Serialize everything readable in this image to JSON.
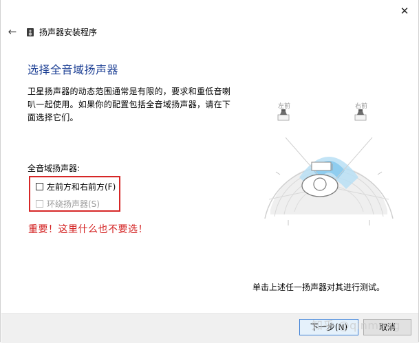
{
  "window": {
    "close_glyph": "✕",
    "back_glyph": "←",
    "app_title": "扬声器安装程序"
  },
  "main": {
    "heading": "选择全音域扬声器",
    "description": "卫星扬声器的动态范围通常是有限的，要求和重低音喇叭一起使用。如果你的配置包括全音域扬声器，请在下面选择它们。",
    "section_label": "全音域扬声器:",
    "options": [
      {
        "label": "左前方和右前方(F)",
        "checked": false,
        "enabled": true
      },
      {
        "label": "环绕扬声器(S)",
        "checked": false,
        "enabled": false
      }
    ],
    "warning": "重要！这里什么也不要选！",
    "test_hint": "单击上述任一扬声器对其进行测试。"
  },
  "diagram": {
    "left_label": "左前",
    "right_label": "右前",
    "accent_color": "#9fd0ef"
  },
  "footer": {
    "next_label": "下一步(N)",
    "cancel_label": "取消"
  },
  "watermark": "知乎 @qinmeng",
  "colors": {
    "heading": "#1c3f94",
    "highlight_border": "#d62626",
    "warning": "#d32020"
  }
}
